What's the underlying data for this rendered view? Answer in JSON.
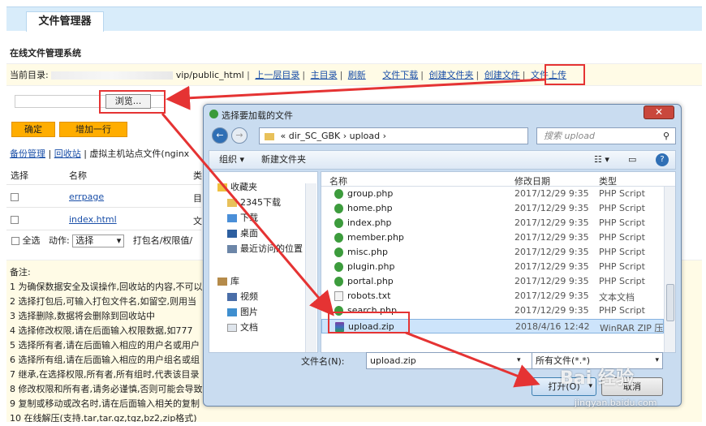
{
  "header": {
    "tab_label": "文件管理器"
  },
  "section_title": "在线文件管理系统",
  "crumb": {
    "label": "当前目录:",
    "path_suffix": "vip/public_html",
    "links": [
      "上一层目录",
      "主目录",
      "刷新",
      "文件下载",
      "创建文件夹",
      "创建文件",
      "文件上传"
    ]
  },
  "upload": {
    "browse_label": "浏览..."
  },
  "buttons": {
    "confirm": "确定",
    "add_row": "增加一行"
  },
  "links2": {
    "backup": "备份管理",
    "recycle": "回收站",
    "vhost_prefix": "虚拟主机站点文件(nginx"
  },
  "table": {
    "headers": [
      "选择",
      "名称",
      "类"
    ],
    "rows": [
      {
        "name": "errpage",
        "type": "目"
      },
      {
        "name": "index.html",
        "type": "文"
      }
    ]
  },
  "actions": {
    "select_all": "全选",
    "action_label": "动作:",
    "select_value": "选择",
    "pack_label": "打包名/权限值/"
  },
  "notes": {
    "title": "备注:",
    "lines": [
      "1 为确保数据安全及误操作,回收站的内容,不可以",
      "2 选择打包后,可输入打包文件名,如留空,则用当",
      "3 选择删除,数据将会删除到回收站中",
      "4 选择修改权限,请在后面输入权限数据,如777",
      "5 选择所有者,请在后面输入相应的用户名或用户",
      "6 选择所有组,请在后面输入相应的用户组名或组",
      "7 继承,在选择权限,所有者,所有组时,代表该目录",
      "8 修改权限和所有者,请务必谨慎,否则可能会导致",
      "9 复制或移动或改名时,请在后面输入相关的复制",
      "10 在线解压(支持.tar,tar.gz,tgz,bz2,zip格式)"
    ]
  },
  "dialog": {
    "title": "选择要加载的文件",
    "path": [
      "«",
      "dir_SC_GBK",
      "›",
      "upload",
      "›"
    ],
    "search_placeholder": "搜索 upload",
    "toolbar": {
      "organize": "组织 ▾",
      "new_folder": "新建文件夹"
    },
    "left_items": [
      {
        "label": "收藏夹",
        "icon": "star-icon"
      },
      {
        "label": "2345下载",
        "icon": "folder-icon"
      },
      {
        "label": "下载",
        "icon": "folder-icon"
      },
      {
        "label": "桌面",
        "icon": "desktop-icon"
      },
      {
        "label": "最近访问的位置",
        "icon": "recent-icon"
      },
      {
        "label": "库",
        "icon": "library-icon"
      },
      {
        "label": "视频",
        "icon": "video-icon"
      },
      {
        "label": "图片",
        "icon": "picture-icon"
      },
      {
        "label": "文档",
        "icon": "document-icon"
      }
    ],
    "columns": [
      "名称",
      "修改日期",
      "类型"
    ],
    "files": [
      {
        "name": "group.php",
        "date": "2017/12/29 9:35",
        "type": "PHP Script"
      },
      {
        "name": "home.php",
        "date": "2017/12/29 9:35",
        "type": "PHP Script"
      },
      {
        "name": "index.php",
        "date": "2017/12/29 9:35",
        "type": "PHP Script"
      },
      {
        "name": "member.php",
        "date": "2017/12/29 9:35",
        "type": "PHP Script"
      },
      {
        "name": "misc.php",
        "date": "2017/12/29 9:35",
        "type": "PHP Script"
      },
      {
        "name": "plugin.php",
        "date": "2017/12/29 9:35",
        "type": "PHP Script"
      },
      {
        "name": "portal.php",
        "date": "2017/12/29 9:35",
        "type": "PHP Script"
      },
      {
        "name": "robots.txt",
        "date": "2017/12/29 9:35",
        "type": "文本文档"
      },
      {
        "name": "search.php",
        "date": "2017/12/29 9:35",
        "type": "PHP Script"
      },
      {
        "name": "upload.zip",
        "date": "2018/4/16 12:42",
        "type": "WinRAR ZIP 压缩"
      }
    ],
    "filename_label": "文件名(N):",
    "filename_value": "upload.zip",
    "filetype_value": "所有文件(*.*)",
    "open_label": "打开(O)",
    "cancel_label": "取消"
  },
  "watermark": {
    "main": "Bai 经验",
    "url": "jingyan.baidu.com"
  }
}
